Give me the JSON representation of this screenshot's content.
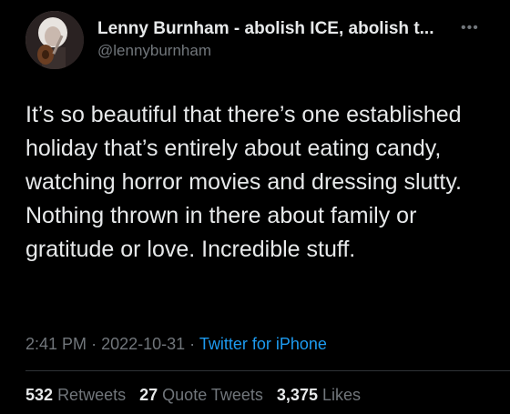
{
  "author": {
    "display_name": "Lenny Burnham - abolish ICE, abolish t...",
    "handle": "@lennyburnham",
    "more_icon": "more-dots-icon"
  },
  "tweet": {
    "text": "It’s so beautiful that there’s one established holiday that’s entirely about eating candy, watching horror movies and dressing slutty. Nothing thrown in there about family or gratitude or love. Incredible stuff."
  },
  "meta": {
    "time": "2:41 PM",
    "separator": "·",
    "date": "2022-10-31",
    "source": "Twitter for iPhone"
  },
  "stats": {
    "retweets_count": "532",
    "retweets_label": "Retweets",
    "quotes_count": "27",
    "quotes_label": "Quote Tweets",
    "likes_count": "3,375",
    "likes_label": "Likes"
  },
  "colors": {
    "background": "#000000",
    "text": "#e7e9ea",
    "secondary": "#71767b",
    "link": "#1d9bf0"
  }
}
